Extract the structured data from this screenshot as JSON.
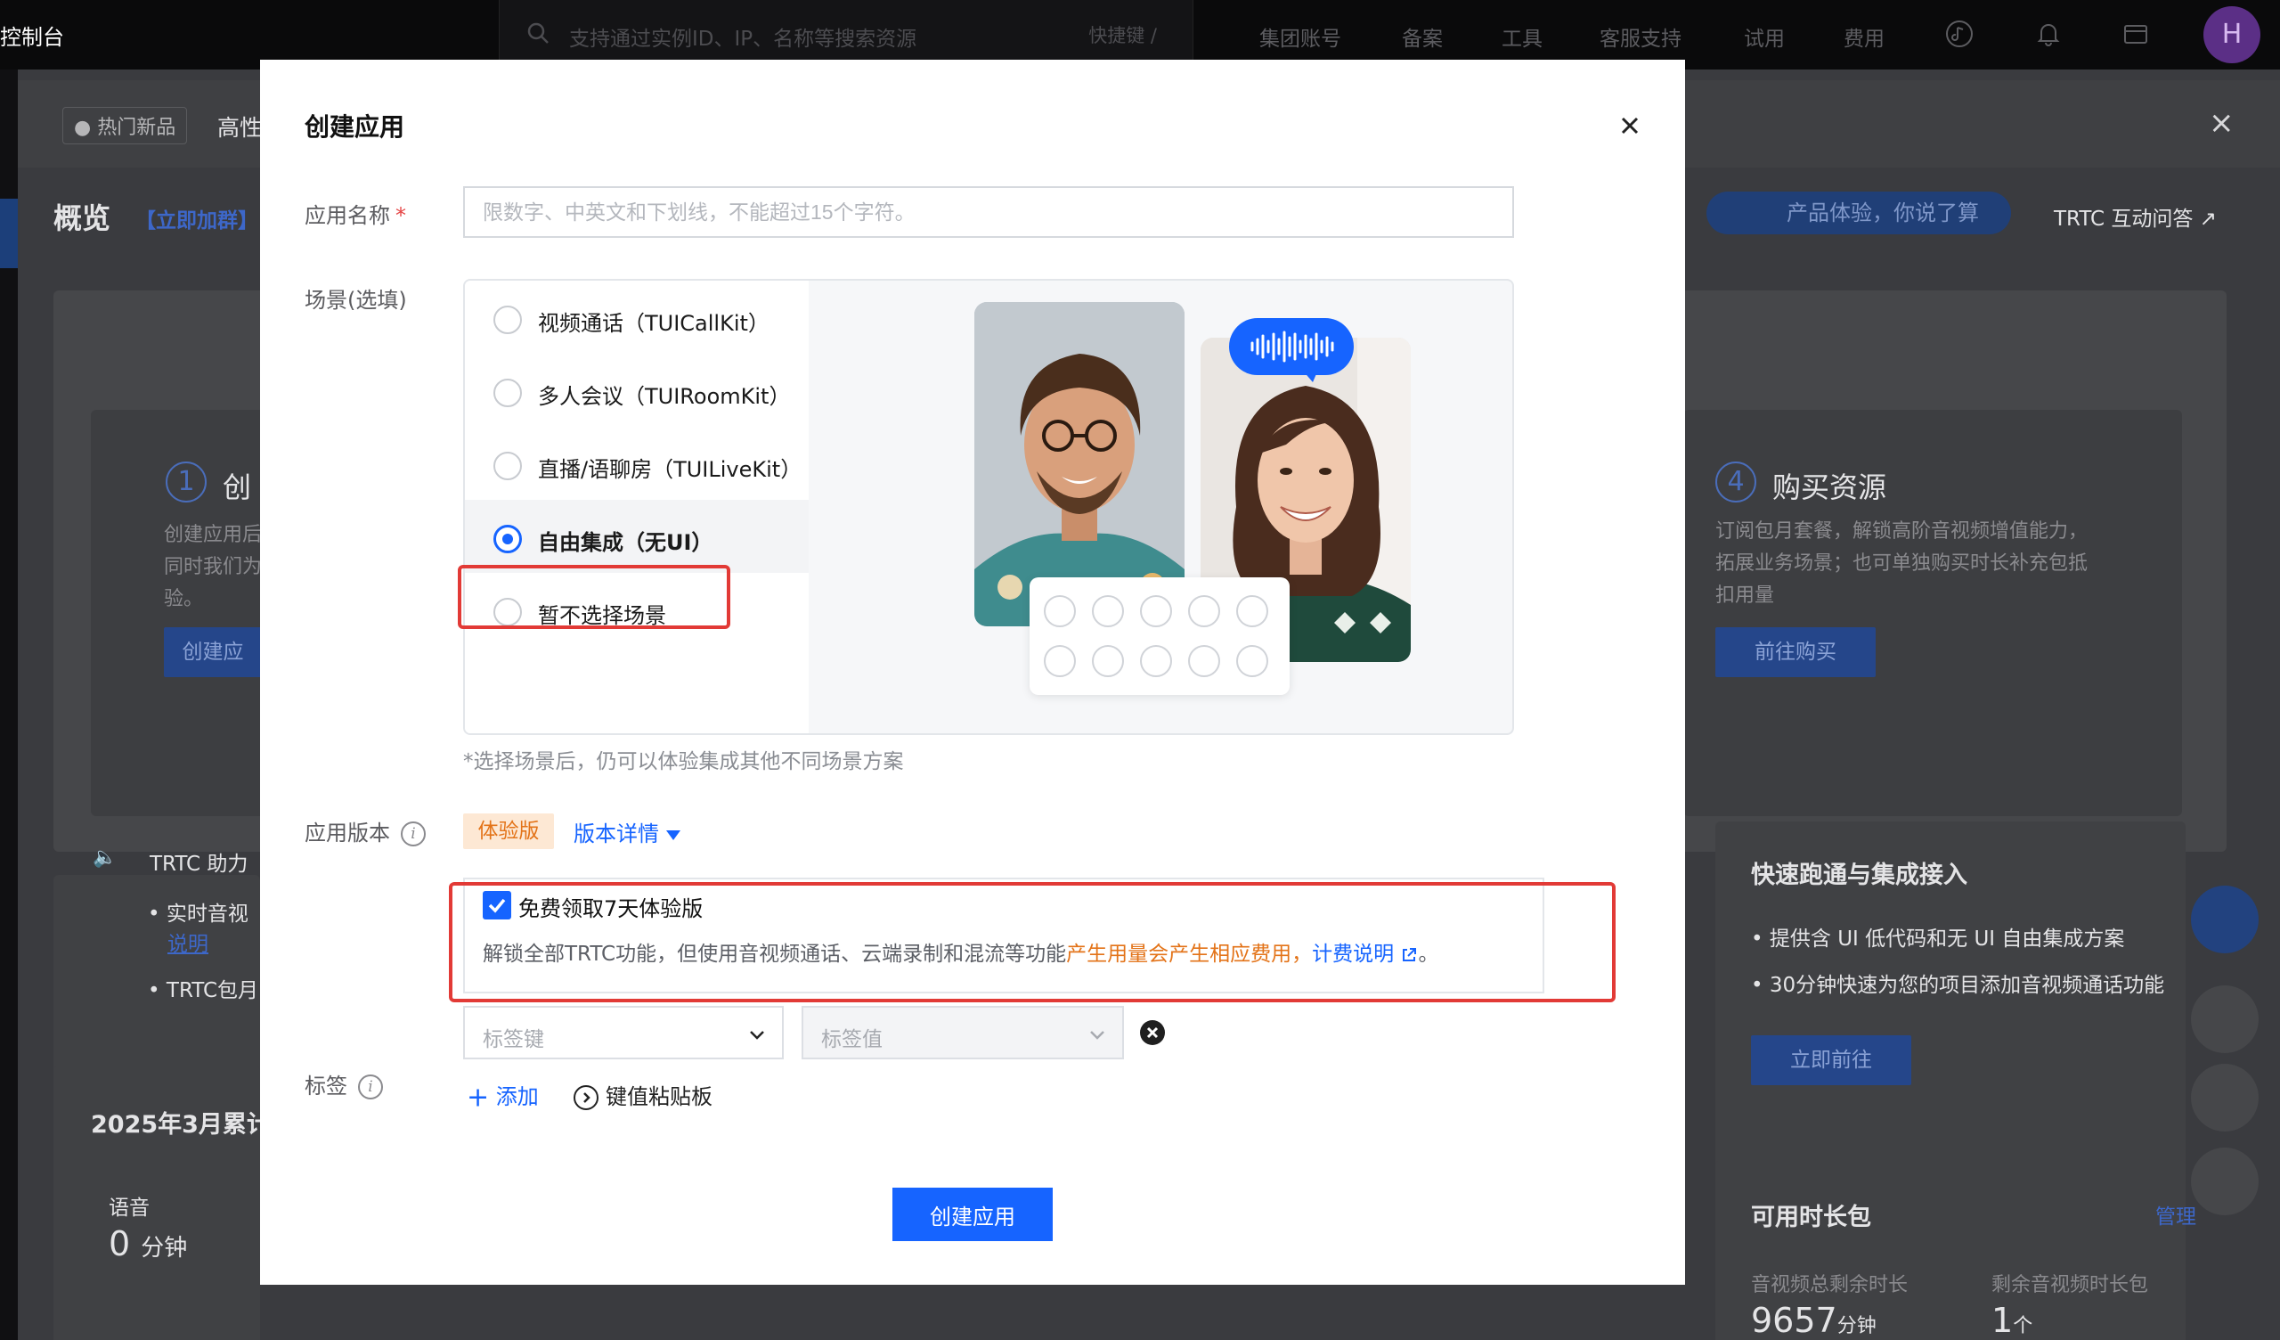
{
  "topnav": {
    "brand": "控制台",
    "search_placeholder": "支持通过实例ID、IP、名称等搜索资源",
    "shortcut": "快捷键 /",
    "menu": [
      "集团账号",
      "备案",
      "工具",
      "客服支持",
      "试用",
      "费用"
    ],
    "avatar_letter": "H"
  },
  "background": {
    "hot_badge": "热门新品",
    "hot_text": "高性",
    "overview_title": "概览",
    "join_group": "【立即加群】",
    "feedback_pill": "产品体验，你说了算",
    "qa_link": "TRTC 互动问答",
    "step1_num": "1",
    "step1_title": "创",
    "step1_desc_1": "创建应用后",
    "step1_desc_2": "同时我们为",
    "step1_desc_3": "验。",
    "step1_btn": "创建应",
    "step4_num": "4",
    "step4_title": "购买资源",
    "step4_desc_1": "订阅包月套餐，解锁高阶音视频增值能力，",
    "step4_desc_2": "拓展业务场景；也可单独购买时长补充包抵",
    "step4_desc_3": "扣用量",
    "step4_btn": "前往购买",
    "assistant_title": "TRTC 助力",
    "assistant_item1": "实时音视",
    "assistant_item1_link": "说明",
    "assistant_item2": "TRTC包月",
    "quick_title": "快速跑通与集成接入",
    "quick_item1": "提供含 UI 低代码和无 UI 自由集成方案",
    "quick_item2": "30分钟快速为您的项目添加音视频通话功能",
    "quick_btn": "立即前往",
    "month_title": "2025年3月累计",
    "voice_label": "语音",
    "voice_value": "0",
    "voice_unit": "分钟",
    "pkg_title": "可用时长包",
    "pkg_manage": "管理",
    "pkg_total_label": "音视频总剩余时长",
    "pkg_total_value": "9657",
    "pkg_total_unit": "分钟",
    "pkg_count_label": "剩余音视频时长包",
    "pkg_count_value": "1",
    "pkg_count_unit": "个"
  },
  "modal": {
    "title": "创建应用",
    "name_label": "应用名称",
    "required_mark": "*",
    "name_placeholder": "限数字、中英文和下划线，不能超过15个字符。",
    "name_value": "",
    "scene_label": "场景(选填)",
    "scenes": [
      {
        "label": "视频通话（TUICallKit）",
        "selected": false
      },
      {
        "label": "多人会议（TUIRoomKit）",
        "selected": false
      },
      {
        "label": "直播/语聊房（TUILiveKit）",
        "selected": false
      },
      {
        "label": "自由集成（无UI）",
        "selected": true
      },
      {
        "label": "暂不选择场景",
        "selected": false
      }
    ],
    "scene_hint": "*选择场景后，仍可以体验集成其他不同场景方案",
    "version_label": "应用版本",
    "version_tag": "体验版",
    "version_detail": "版本详情",
    "trial_checkbox_label": "免费领取7天体验版",
    "trial_checked": true,
    "trial_desc_prefix": "解锁全部TRTC功能，但使用音视频通话、云端录制和混流等功能",
    "trial_desc_warning": "产生用量会产生相应费用，",
    "trial_desc_link": "计费说明",
    "trial_desc_suffix": "。",
    "tag_label": "标签",
    "tag_key_placeholder": "标签键",
    "tag_value_placeholder": "标签值",
    "add_label": "添加",
    "paste_label": "键值粘贴板",
    "submit": "创建应用"
  },
  "colors": {
    "primary": "#1664ff",
    "warning": "#e37318",
    "highlight_frame": "#e23a36"
  }
}
